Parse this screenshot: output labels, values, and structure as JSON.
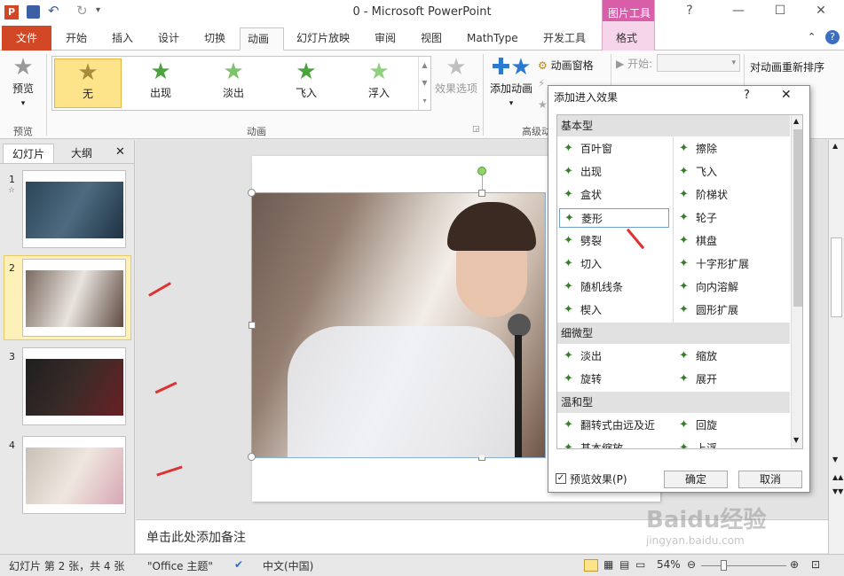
{
  "window": {
    "title": "0  -  Microsoft PowerPoint",
    "help": "?"
  },
  "tabs": {
    "file": "文件",
    "items": [
      "开始",
      "插入",
      "设计",
      "切换",
      "动画",
      "幻灯片放映",
      "审阅",
      "视图",
      "MathType",
      "开发工具"
    ],
    "picture_tools": "图片工具",
    "format": "格式"
  },
  "ribbon": {
    "preview_label": "预览",
    "preview_group": "预览",
    "gallery": [
      "无",
      "出现",
      "淡出",
      "飞入",
      "浮入"
    ],
    "animation_group": "动画",
    "effect_options": "效果选项",
    "add_animation": "添加动画",
    "animation_pane": "动画窗格",
    "start_label": "开始:",
    "advanced_group": "高级动",
    "reorder_label": "对动画重新排序"
  },
  "left_panel": {
    "tab_slides": "幻灯片",
    "tab_outline": "大纲",
    "slides": [
      "1",
      "2",
      "3",
      "4"
    ]
  },
  "notes": {
    "placeholder": "单击此处添加备注"
  },
  "status": {
    "slide_info": "幻灯片 第 2 张，共 4 张",
    "theme": "\"Office 主题\"",
    "language": "中文(中国)",
    "zoom": "54%"
  },
  "dialog": {
    "title": "添加进入效果",
    "categories": [
      "基本型",
      "细微型",
      "温和型"
    ],
    "basic_left": [
      "百叶窗",
      "出现",
      "盒状",
      "菱形",
      "劈裂",
      "切入",
      "随机线条",
      "楔入"
    ],
    "basic_right": [
      "擦除",
      "飞入",
      "阶梯状",
      "轮子",
      "棋盘",
      "十字形扩展",
      "向内溶解",
      "圆形扩展"
    ],
    "subtle_left": [
      "淡出",
      "旋转"
    ],
    "subtle_right": [
      "缩放",
      "展开"
    ],
    "moderate_left": [
      "翻转式由远及近",
      "基本缩放"
    ],
    "moderate_right": [
      "回旋",
      "上浮"
    ],
    "preview_checkbox": "预览效果(P)",
    "ok": "确定",
    "cancel": "取消"
  },
  "watermark": {
    "brand": "Baidu经验",
    "url": "jingyan.baidu.com"
  },
  "colors": {
    "file_tab": "#d24726",
    "selected_gallery": "#fde38a",
    "picture_tools": "#f6d5ea",
    "arrow": "#e03030"
  }
}
